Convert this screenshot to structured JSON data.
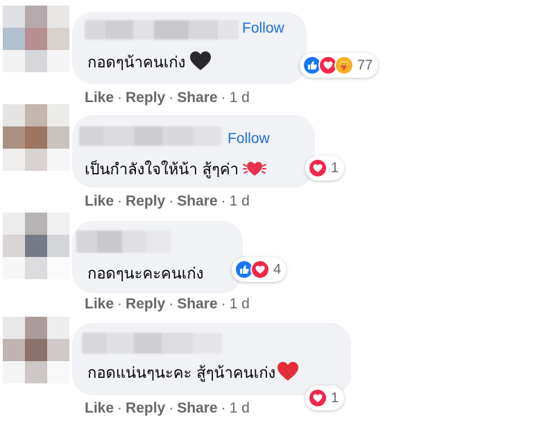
{
  "follow_label": "Follow",
  "actions": {
    "like": "Like",
    "reply": "Reply",
    "share": "Share",
    "sep": "·",
    "time": "1 d"
  },
  "colors": {
    "bubble": "#f0f2f5",
    "link": "#216fdb",
    "meta": "#65676b",
    "like": "#1877f2",
    "love": "#f0284a"
  },
  "comments": [
    {
      "text": "กอดๆน้าคนเก่ง",
      "trailing_emoji": "black-heart-icon",
      "has_follow": true,
      "reactions": {
        "icons": [
          "like",
          "love",
          "care"
        ],
        "count": "77"
      }
    },
    {
      "text": "เป็นกำลังใจให้น้า สู้ๆค่า",
      "trailing_emoji": "beating-heart-icon",
      "has_follow": true,
      "reactions": {
        "icons": [
          "love"
        ],
        "count": "1"
      }
    },
    {
      "text": "กอดๆนะคะคนเก่ง",
      "trailing_emoji": "",
      "has_follow": false,
      "reactions": {
        "icons": [
          "like",
          "love"
        ],
        "count": "4"
      }
    },
    {
      "text": "กอดแน่นๆนะคะ สู้ๆน้าคนเก่ง",
      "trailing_emoji": "red-heart-icon",
      "has_follow": false,
      "reactions": {
        "icons": [
          "love"
        ],
        "count": "1"
      }
    }
  ]
}
